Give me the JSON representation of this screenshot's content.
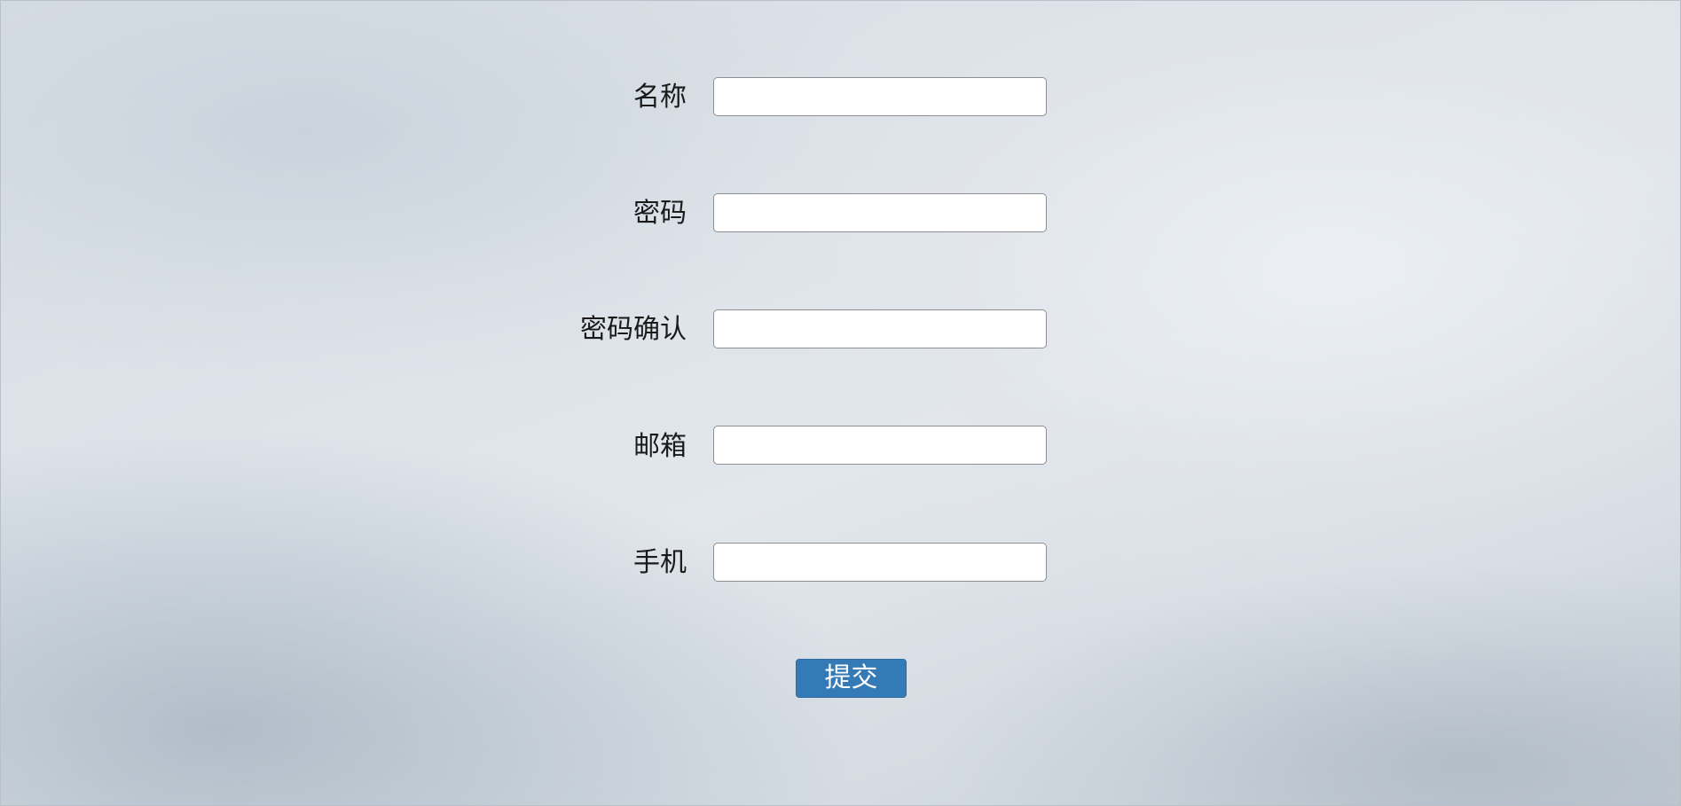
{
  "form": {
    "fields": [
      {
        "label": "名称",
        "value": "",
        "placeholder": ""
      },
      {
        "label": "密码",
        "value": "",
        "placeholder": ""
      },
      {
        "label": "密码确认",
        "value": "",
        "placeholder": ""
      },
      {
        "label": "邮箱",
        "value": "",
        "placeholder": ""
      },
      {
        "label": "手机",
        "value": "",
        "placeholder": ""
      }
    ],
    "submit_label": "提交"
  },
  "colors": {
    "button_background": "#337ab7",
    "button_text": "#ffffff",
    "label_text": "#1a1a1a",
    "input_border": "#8e8e8e"
  }
}
